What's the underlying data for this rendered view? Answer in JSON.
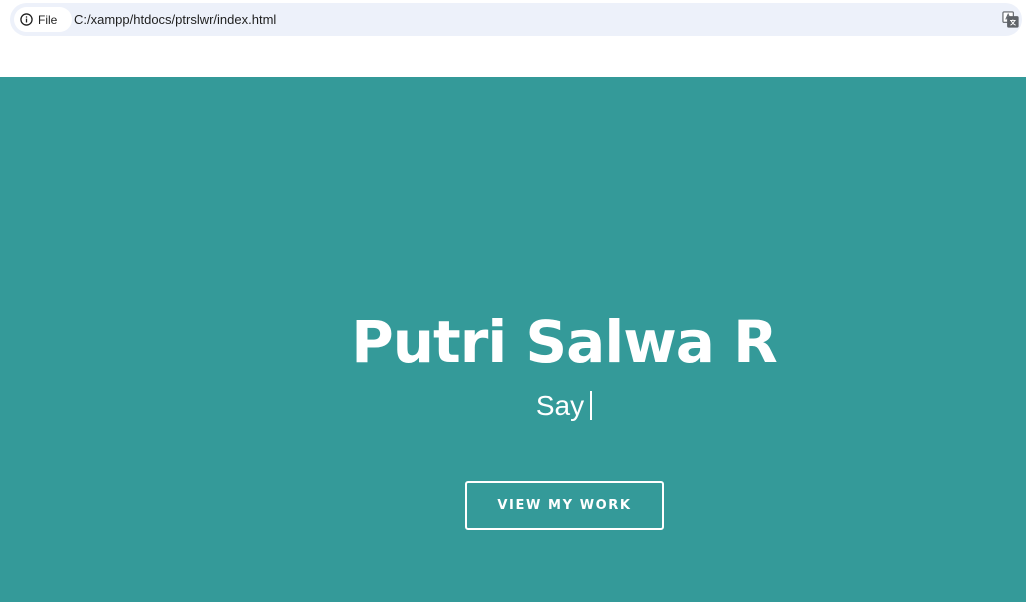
{
  "browser": {
    "site_chip_label": "File",
    "url": "C:/xampp/htdocs/ptrslwr/index.html",
    "icons": {
      "site_info": "info-icon",
      "translate": "translate-icon"
    }
  },
  "hero": {
    "name": "Putri Salwa R",
    "subtitle": "Say",
    "button_label": "VIEW MY WORK",
    "colors": {
      "background": "#349a99",
      "text": "#ffffff"
    }
  }
}
